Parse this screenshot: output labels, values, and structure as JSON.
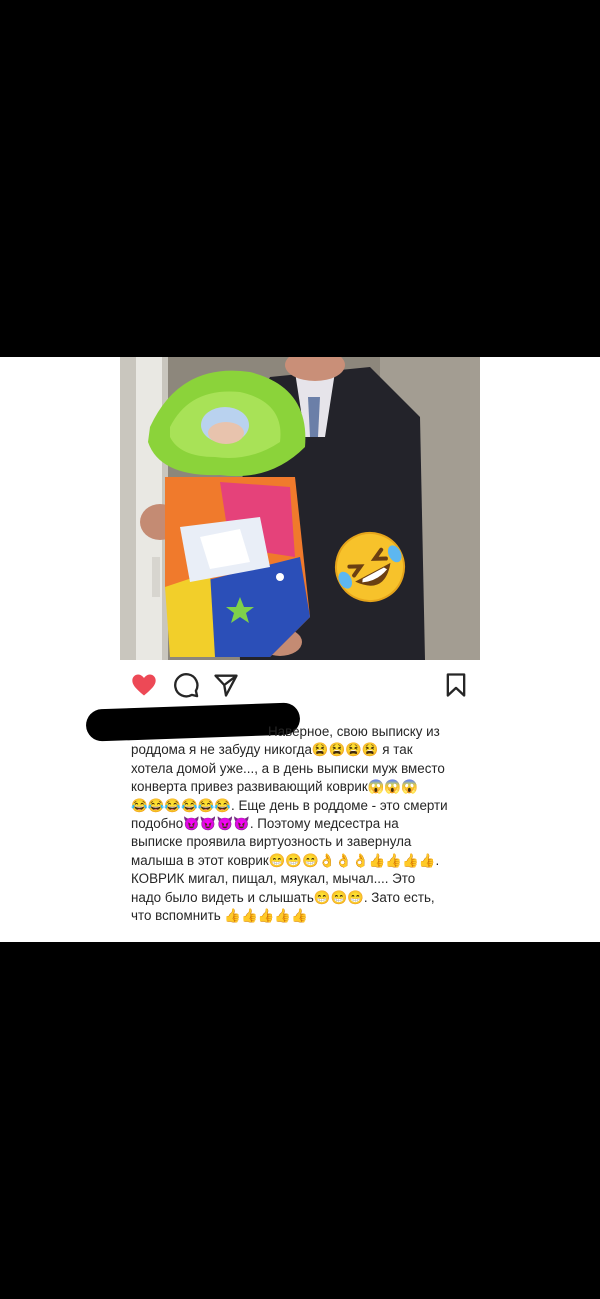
{
  "post": {
    "photo": {
      "sticker": "rolling-on-floor-laughing-emoji"
    },
    "actions": {
      "like": {
        "icon": "heart-icon",
        "color": "#ed4956",
        "state": "liked"
      },
      "comment": {
        "icon": "comment-icon"
      },
      "share": {
        "icon": "send-icon"
      },
      "save": {
        "icon": "bookmark-icon"
      }
    },
    "caption": {
      "username": "redacted",
      "lines": [
        "Наверное, свою выписку из",
        "роддома я не забуду никогда😫😫😫😫 я так",
        "хотела домой уже..., а в день выписки муж вместо",
        "конверта привез развивающий коврик😱😱😱",
        "😂😂😂😂😂😂. Еще день в роддоме - это смерти",
        "подобно😈😈😈😈. Поэтому медсестра на",
        "выписке проявила виртуозность и завернула",
        "малыша в этот коврик😁😁😁👌👌👌👍👍👍👍.",
        "КОВРИК  мигал, пищал, мяукал, мычал.... Это",
        "надо было видеть и слышать😁😁😁. Зато есть,",
        "что вспомнить 👍👍👍👍👍"
      ]
    }
  }
}
